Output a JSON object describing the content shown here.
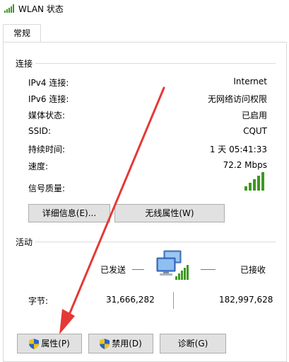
{
  "window": {
    "title": "WLAN 状态"
  },
  "tabs": [
    {
      "label": "常规"
    }
  ],
  "connection": {
    "section_label": "连接",
    "rows": [
      {
        "label": "IPv4 连接:",
        "value": "Internet"
      },
      {
        "label": "IPv6 连接:",
        "value": "无网络访问权限"
      },
      {
        "label": "媒体状态:",
        "value": "已启用"
      },
      {
        "label": "SSID:",
        "value": "CQUT"
      },
      {
        "label": "持续时间:",
        "value": "1 天 05:41:33"
      },
      {
        "label": "速度:",
        "value": "72.2 Mbps"
      }
    ],
    "signal_label": "信号质量:",
    "signal_bars": 5,
    "signal_bars_filled": 5
  },
  "buttons_top": {
    "details": "详细信息(E)...",
    "wireless_props": "无线属性(W)"
  },
  "activity": {
    "section_label": "活动",
    "sent_label": "已发送",
    "received_label": "已接收",
    "bytes_label": "字节:",
    "bytes_sent": "31,666,282",
    "bytes_received": "182,997,628"
  },
  "buttons_bottom": {
    "properties": "属性(P)",
    "disable": "禁用(D)",
    "diagnose": "诊断(G)"
  },
  "colors": {
    "signal_green": "#3c9a1f",
    "annotation_red": "#e53935",
    "shield_blue": "#2a63c8",
    "shield_yellow": "#f0c419"
  },
  "icons": {
    "title": "wifi-signal-icon",
    "network": "network-computers-icon",
    "shield": "uac-shield-icon"
  }
}
